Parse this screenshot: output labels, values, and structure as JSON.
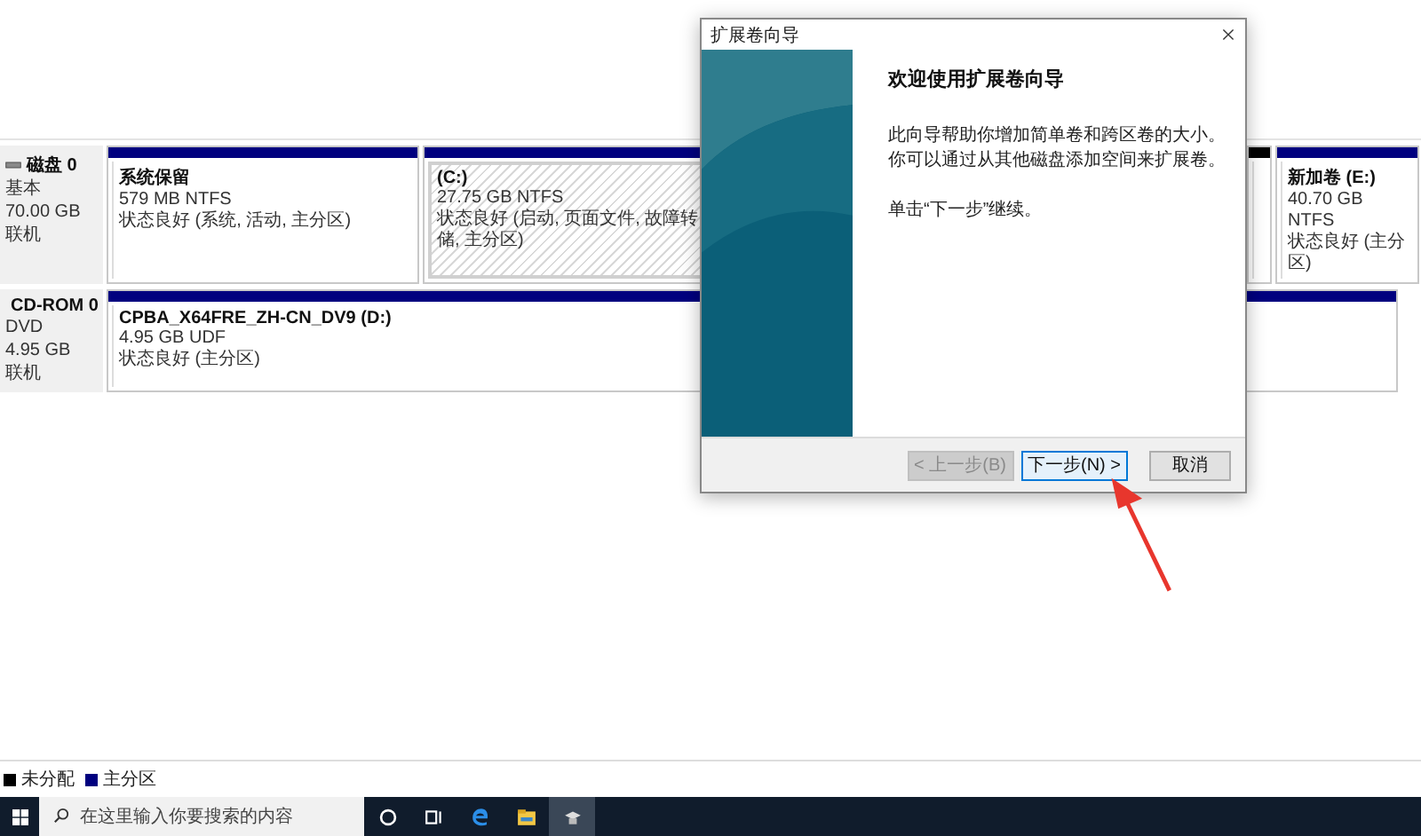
{
  "disks": [
    {
      "kind": "disk",
      "name": "磁盘 0",
      "type": "基本",
      "size": "70.00 GB",
      "status": "联机",
      "partitions": [
        {
          "kind": "primary",
          "name": "系统保留",
          "size": "579 MB NTFS",
          "status": "状态良好 (系统, 活动, 主分区)",
          "selected": false
        },
        {
          "kind": "primary",
          "name": "(C:)",
          "size": "27.75 GB NTFS",
          "status": "状态良好 (启动, 页面文件, 故障转储, 主分区)",
          "selected": true
        },
        {
          "kind": "unallocated"
        },
        {
          "kind": "primary",
          "name": "新加卷 (E:)",
          "size": "40.70 GB NTFS",
          "status": "状态良好 (主分区)",
          "selected": false
        }
      ]
    },
    {
      "kind": "cdrom",
      "name": "CD-ROM 0",
      "type": "DVD",
      "size": "4.95 GB",
      "status": "联机",
      "partitions": [
        {
          "kind": "primary",
          "name": "CPBA_X64FRE_ZH-CN_DV9  (D:)",
          "size": "4.95 GB UDF",
          "status": "状态良好 (主分区)",
          "selected": false
        }
      ]
    }
  ],
  "legend": [
    {
      "label": "未分配",
      "color": "#000000"
    },
    {
      "label": "主分区",
      "color": "#00007f"
    }
  ],
  "dialog": {
    "title": "扩展卷向导",
    "heading": "欢迎使用扩展卷向导",
    "paragraphs": [
      "此向导帮助你增加简单卷和跨区卷的大小。你可以通过从其他磁盘添加空间来扩展卷。",
      "单击“下一步”继续。"
    ],
    "buttons": [
      {
        "label": "< 上一步(B)",
        "disabled": true,
        "focused": false
      },
      {
        "label": "下一步(N) >",
        "disabled": false,
        "focused": true
      },
      {
        "label": "取消",
        "disabled": false,
        "focused": false
      }
    ]
  },
  "taskbar": {
    "search": {
      "placeholder": "在这里输入你要搜索的内容"
    }
  }
}
